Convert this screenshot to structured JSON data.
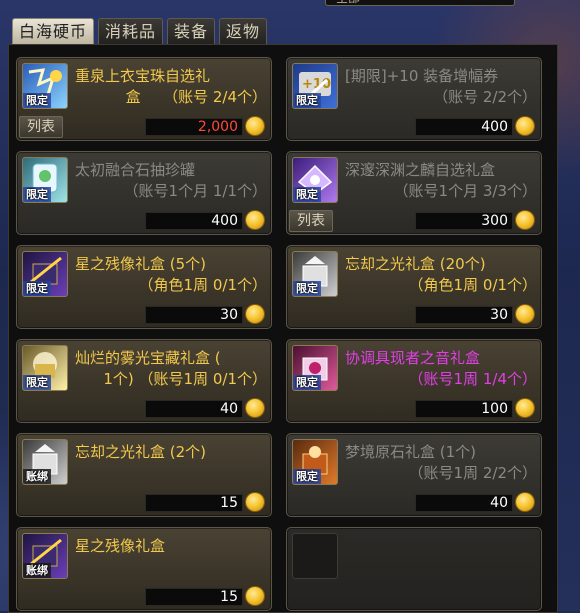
{
  "top_dropdown": "全部",
  "tabs": [
    "白海硬币",
    "消耗品",
    "装备",
    "返物"
  ],
  "items": [
    {
      "name": "重泉上衣宝珠自选礼",
      "sub": "盒　　（账号 2/4个）",
      "badge": "限定",
      "price": "2,000",
      "list_button": "列表"
    },
    {
      "name": "[期限]+10 装备增幅券",
      "sub": "（账号 2/2个）",
      "badge": "限定",
      "price": "400",
      "list_button": ""
    },
    {
      "name": "太初融合石抽珍罐",
      "sub": "（账号1个月 1/1个）",
      "badge": "限定",
      "price": "400",
      "list_button": ""
    },
    {
      "name": "深邃深渊之麟自选礼盒",
      "sub": "（账号1个月 3/3个）",
      "badge": "限定",
      "price": "300",
      "list_button": "列表"
    },
    {
      "name": "星之残像礼盒 (5个)",
      "sub": "（角色1周 0/1个）",
      "badge": "限定",
      "price": "30",
      "list_button": ""
    },
    {
      "name": "忘却之光礼盒 (20个)",
      "sub": "（角色1周 0/1个）",
      "badge": "限定",
      "price": "30",
      "list_button": ""
    },
    {
      "name": "灿烂的雾光宝藏礼盒 (",
      "sub": "1个) （账号1周 0/1个）",
      "badge": "限定",
      "price": "40",
      "list_button": ""
    },
    {
      "name": "协调具现者之音礼盒",
      "sub": "（账号1周 1/4个）",
      "badge": "限定",
      "price": "100",
      "list_button": ""
    },
    {
      "name": "忘却之光礼盒 (2个)",
      "sub": "",
      "badge": "账绑",
      "price": "15",
      "list_button": ""
    },
    {
      "name": "梦境原石礼盒 (1个)",
      "sub": "（账号1周 2/2个）",
      "badge": "限定",
      "price": "40",
      "list_button": ""
    },
    {
      "name": "星之残像礼盒",
      "sub": "",
      "badge": "账绑",
      "price": "15",
      "list_button": ""
    }
  ],
  "colors": {
    "gold_text": "#f2c94c",
    "gray_text": "#8a8a84",
    "pink_text": "#e23ee6",
    "red_price": "#ff4a3a"
  },
  "icons": [
    "coin-icon",
    "gift-box-icon",
    "amplify-ticket-icon",
    "stone-jar-icon",
    "abyss-box-icon",
    "afterimage-box-icon",
    "light-box-icon",
    "treasure-box-icon",
    "harmony-box-icon",
    "dream-stone-box-icon"
  ]
}
